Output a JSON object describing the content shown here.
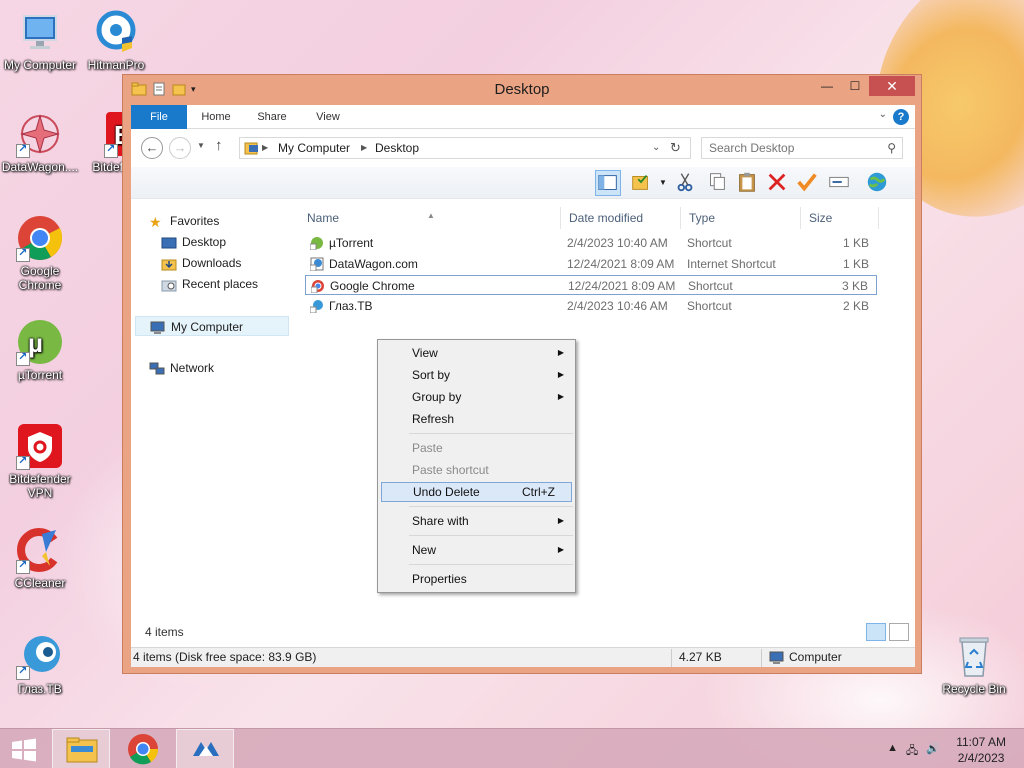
{
  "desktop": {
    "icons": [
      {
        "label": "My Computer",
        "icon": "computer-icon"
      },
      {
        "label": "HitmanPro",
        "icon": "hitmanpro-icon"
      },
      {
        "label": "DataWagon....",
        "icon": "datawagon-icon"
      },
      {
        "label": "Bitdefe...",
        "icon": "bitdefender-icon"
      },
      {
        "label": "Google Chrome",
        "icon": "chrome-icon"
      },
      {
        "label": "µTorrent",
        "icon": "utorrent-icon"
      },
      {
        "label": "Bitdefender VPN",
        "icon": "bitdefender-vpn-icon"
      },
      {
        "label": "CCleaner",
        "icon": "ccleaner-icon"
      },
      {
        "label": "Глаз.ТВ",
        "icon": "glaztv-icon"
      },
      {
        "label": "Recycle Bin",
        "icon": "recycle-bin-icon"
      }
    ]
  },
  "window": {
    "title": "Desktop",
    "controls": {
      "minimize": "—",
      "maximize": "☐",
      "close": "✕"
    }
  },
  "ribbon": {
    "tabs": [
      "File",
      "Home",
      "Share",
      "View"
    ],
    "help": "?"
  },
  "address": {
    "crumbs": [
      "My Computer",
      "Desktop"
    ],
    "search_placeholder": "Search Desktop"
  },
  "navpane": {
    "favorites": "Favorites",
    "desktop": "Desktop",
    "downloads": "Downloads",
    "recent": "Recent places",
    "computer": "My Computer",
    "network": "Network"
  },
  "filelist": {
    "columns": [
      "Name",
      "Date modified",
      "Type",
      "Size"
    ],
    "rows": [
      {
        "name": "µTorrent",
        "date": "2/4/2023 10:40 AM",
        "type": "Shortcut",
        "size": "1 KB"
      },
      {
        "name": "DataWagon.com",
        "date": "12/24/2021 8:09 AM",
        "type": "Internet Shortcut",
        "size": "1 KB"
      },
      {
        "name": "Google Chrome",
        "date": "12/24/2021 8:09 AM",
        "type": "Shortcut",
        "size": "3 KB"
      },
      {
        "name": "Глаз.ТВ",
        "date": "2/4/2023 10:46 AM",
        "type": "Shortcut",
        "size": "2 KB"
      }
    ],
    "item_count": "4 items"
  },
  "statusbar": {
    "info": "4 items (Disk free space: 83.9 GB)",
    "size": "4.27 KB",
    "location": "Computer"
  },
  "context_menu": {
    "view": "View",
    "sort_by": "Sort by",
    "group_by": "Group by",
    "refresh": "Refresh",
    "paste": "Paste",
    "paste_shortcut": "Paste shortcut",
    "undo_delete": "Undo Delete",
    "undo_shortcut": "Ctrl+Z",
    "share_with": "Share with",
    "new": "New",
    "properties": "Properties"
  },
  "taskbar": {
    "time": "11:07 AM",
    "date": "2/4/2023"
  },
  "colors": {
    "window_frame": "#eaa383",
    "accent": "#1979ca",
    "close": "#c75050"
  }
}
